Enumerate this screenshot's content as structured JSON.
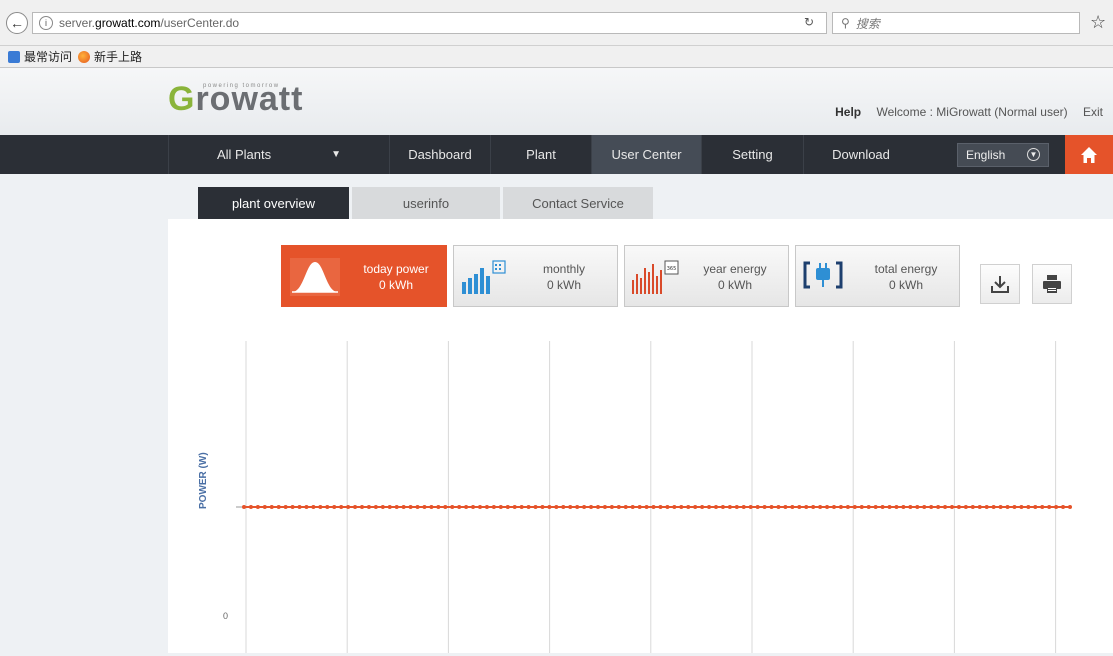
{
  "browser": {
    "url_prefix": "server.",
    "url_host": "growatt.com",
    "url_path": "/userCenter.do",
    "search_placeholder": "搜索",
    "bookmark_1": "最常访问",
    "bookmark_2": "新手上路"
  },
  "header": {
    "logo_g": "G",
    "logo_rest": "rowatt",
    "tagline": "powering tomorrow",
    "help": "Help",
    "welcome": "Welcome : MiGrowatt (Normal user)",
    "exit": "Exit"
  },
  "nav": {
    "items": [
      "All Plants",
      "Dashboard",
      "Plant",
      "User Center",
      "Setting",
      "Download"
    ],
    "active_index": 3,
    "dropdown_arrow": "▼",
    "language": "English"
  },
  "tabs": {
    "items": [
      "plant overview",
      "userinfo",
      "Contact Service"
    ],
    "active_index": 0
  },
  "stats": [
    {
      "label": "today power",
      "value": "0 kWh",
      "active": true,
      "icon": "curve-icon"
    },
    {
      "label": "monthly",
      "value": "0 kWh",
      "active": false,
      "icon": "bar-calendar-icon"
    },
    {
      "label": "year energy",
      "value": "0 kWh",
      "active": false,
      "icon": "bar-365-icon"
    },
    {
      "label": "total energy",
      "value": "0 kWh",
      "active": false,
      "icon": "plug-icon"
    }
  ],
  "colors": {
    "accent": "#e5532a",
    "nav_bg": "#2b2f36",
    "series": "#e5532a"
  },
  "chart_data": {
    "type": "line",
    "ylabel": "POWER (W)",
    "y_ticks": [
      "0"
    ],
    "series": [
      {
        "values_constant": 0,
        "point_count": 120
      }
    ],
    "vertical_grid_lines": 9
  }
}
